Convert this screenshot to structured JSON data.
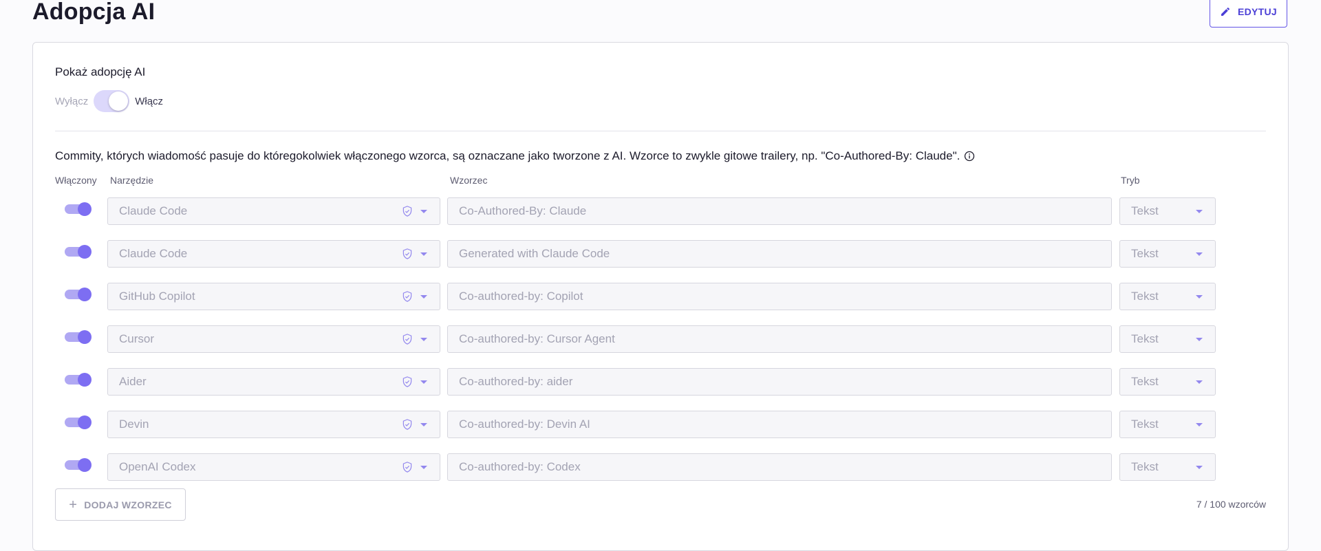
{
  "page": {
    "title": "Adopcja AI",
    "edit_label": "EDYTUJ"
  },
  "settings": {
    "show_label": "Pokaż adopcję AI",
    "off_label": "Wyłącz",
    "on_label": "Włącz",
    "enabled": true
  },
  "description": "Commity, których wiadomość pasuje do któregokolwiek włączonego wzorca, są oznaczane jako tworzone z AI. Wzorce to zwykle gitowe trailery, np. \"Co-Authored-By: Claude\".",
  "columns": {
    "enabled": "Włączony",
    "tool": "Narzędzie",
    "pattern": "Wzorzec",
    "mode": "Tryb"
  },
  "rows": [
    {
      "enabled": true,
      "tool": "Claude Code",
      "pattern": "Co-Authored-By: Claude",
      "mode": "Tekst"
    },
    {
      "enabled": true,
      "tool": "Claude Code",
      "pattern": "Generated with Claude Code",
      "mode": "Tekst"
    },
    {
      "enabled": true,
      "tool": "GitHub Copilot",
      "pattern": "Co-authored-by: Copilot",
      "mode": "Tekst"
    },
    {
      "enabled": true,
      "tool": "Cursor",
      "pattern": "Co-authored-by: Cursor Agent",
      "mode": "Tekst"
    },
    {
      "enabled": true,
      "tool": "Aider",
      "pattern": "Co-authored-by: aider",
      "mode": "Tekst"
    },
    {
      "enabled": true,
      "tool": "Devin",
      "pattern": "Co-authored-by: Devin AI",
      "mode": "Tekst"
    },
    {
      "enabled": true,
      "tool": "OpenAI Codex",
      "pattern": "Co-authored-by: Codex",
      "mode": "Tekst"
    }
  ],
  "footer": {
    "add_label": "DODAJ WZORZEC",
    "count": "7 / 100 wzorców"
  },
  "colors": {
    "accent": "#6354e6",
    "toggle_knob": "#7d6ef2",
    "toggle_track": "#b0a8f3"
  },
  "icons": {
    "edit": "pencil-icon",
    "info": "info-icon",
    "tool_badge": "shield-check-icon",
    "dropdown": "chevron-down-icon",
    "add": "plus-icon"
  }
}
